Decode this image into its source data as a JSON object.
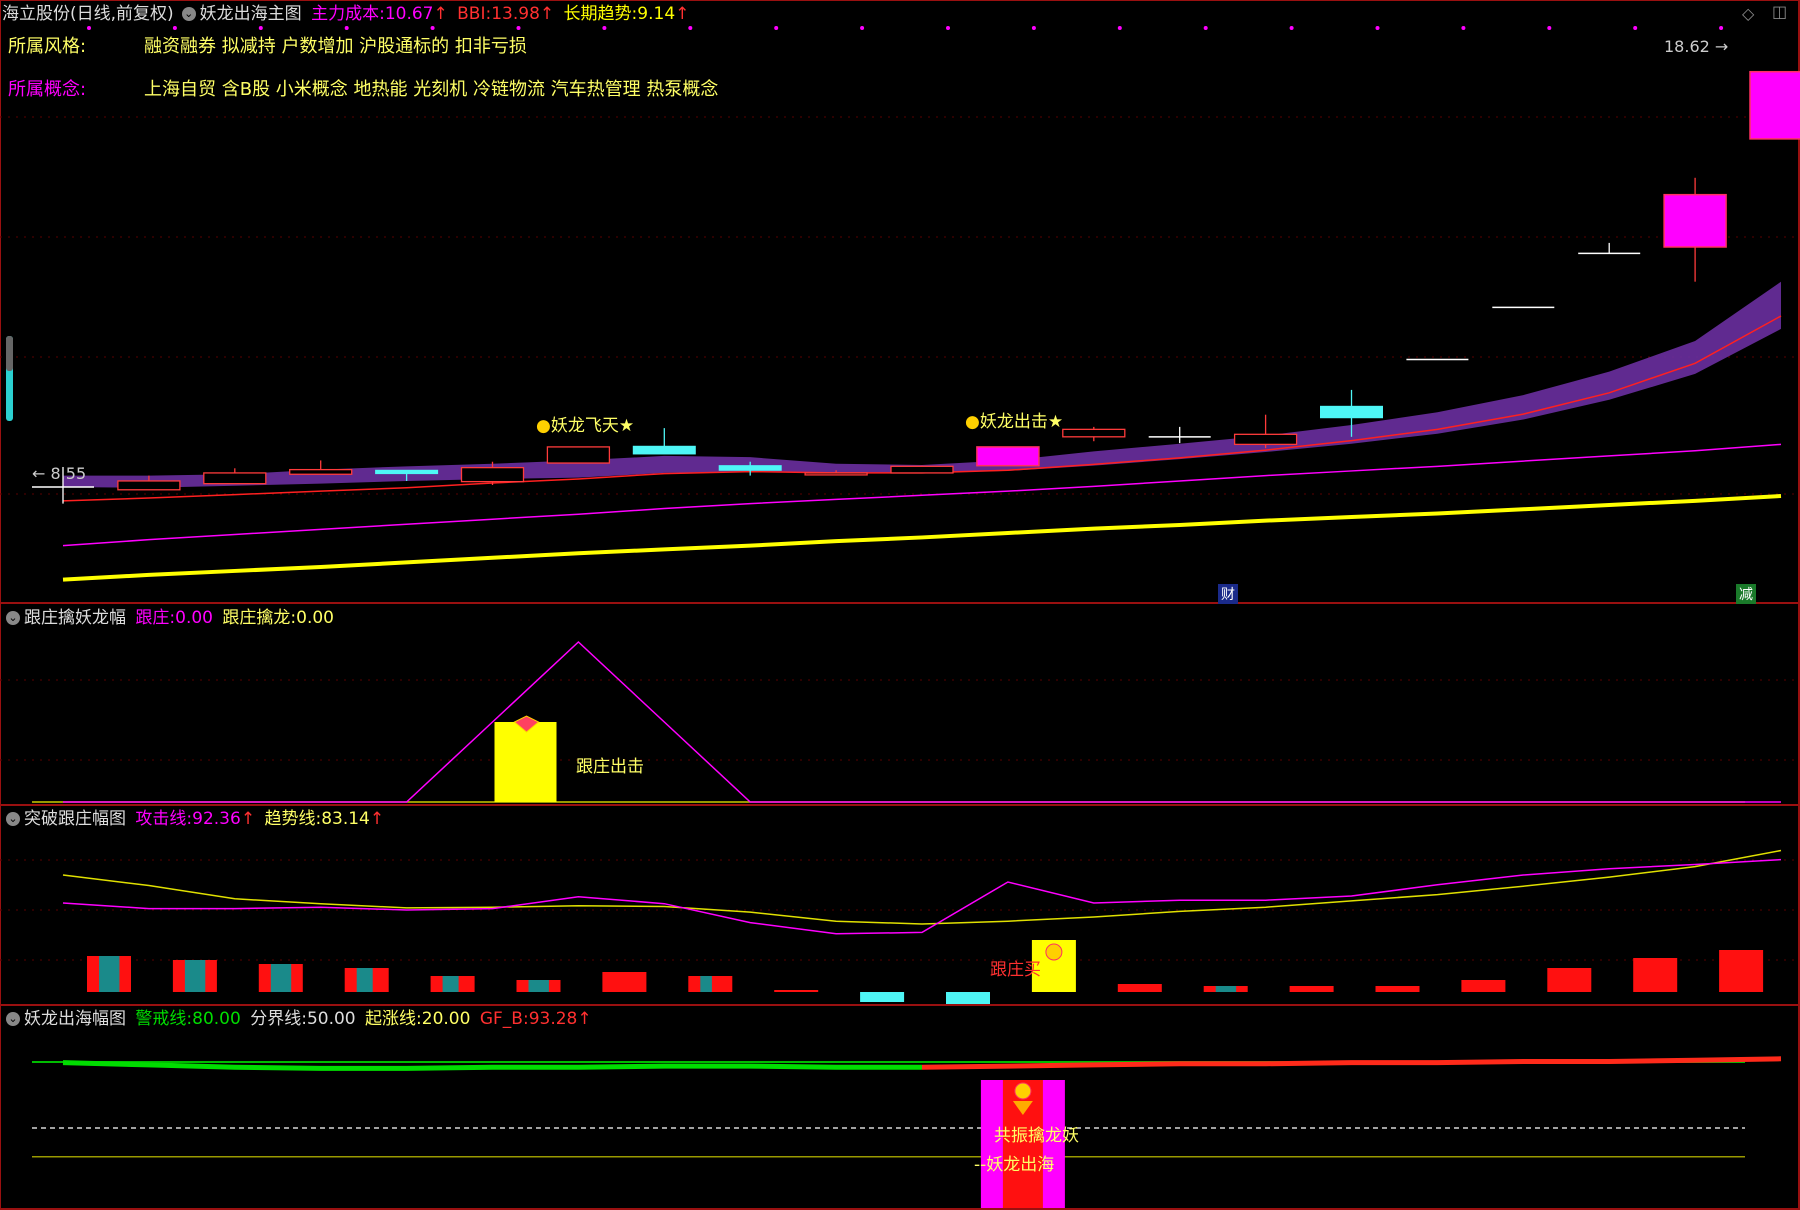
{
  "main_header": {
    "stock": "海立股份(日线,前复权)",
    "indicator": "妖龙出海主图",
    "cost_label": "主力成本:",
    "cost_value": "10.67",
    "bbi_label": "BBI:",
    "bbi_value": "13.98",
    "trend_label": "长期趋势:",
    "trend_value": "9.14"
  },
  "info": {
    "style_label": "所属风格:",
    "style_value": "融资融券 拟减持 户数增加 沪股通标的 扣非亏损",
    "concept_label": "所属概念:",
    "concept_value": "上海自贸 含B股 小米概念 地热能 光刻机 冷链物流 汽车热管理 热泵概念"
  },
  "price_labels": {
    "high": "18.62",
    "low": "8.55"
  },
  "signals": {
    "s1": "妖龙飞天★",
    "s2": "妖龙出击★"
  },
  "tags": {
    "cai": "财",
    "jian": "减"
  },
  "panel2": {
    "title": "跟庄擒妖龙幅",
    "a_label": "跟庄:",
    "a_value": "0.00",
    "b_label": "跟庄擒龙:",
    "b_value": "0.00",
    "signal": "跟庄出击"
  },
  "panel3": {
    "title": "突破跟庄幅图",
    "a_label": "攻击线:",
    "a_value": "92.36",
    "b_label": "趋势线:",
    "b_value": "83.14",
    "signal": "跟庄买"
  },
  "panel4": {
    "title": "妖龙出海幅图",
    "a_label": "警戒线:",
    "a_value": "80.00",
    "b_label": "分界线:",
    "b_value": "50.00",
    "c_label": "起涨线:",
    "c_value": "20.00",
    "d_label": "GF_B:",
    "d_value": "93.28",
    "signal1": "共振擒龙妖",
    "signal2": "妖龙出海"
  },
  "colors": {
    "up": "#ff3b3b",
    "down": "#4ef6f6",
    "magenta": "#ff00ff",
    "yellow": "#ffff00",
    "purple": "#6a2fa0",
    "green": "#00dd00",
    "bg": "#000000"
  },
  "chart_data": {
    "type": "candlestick",
    "x": [
      1,
      2,
      3,
      4,
      5,
      6,
      7,
      8,
      9,
      10,
      11,
      12,
      13,
      14,
      15,
      16,
      17,
      18,
      19,
      20,
      21
    ],
    "candles": [
      {
        "o": 8.79,
        "h": 9.09,
        "l": 8.55,
        "c": 8.79
      },
      {
        "o": 8.75,
        "h": 8.96,
        "l": 8.75,
        "c": 8.88
      },
      {
        "o": 8.84,
        "h": 9.07,
        "l": 8.84,
        "c": 9.0
      },
      {
        "o": 8.98,
        "h": 9.19,
        "l": 8.98,
        "c": 9.05
      },
      {
        "o": 9.04,
        "h": 9.04,
        "l": 8.88,
        "c": 8.99
      },
      {
        "o": 8.87,
        "h": 9.17,
        "l": 8.82,
        "c": 9.08
      },
      {
        "o": 9.15,
        "h": 9.4,
        "l": 9.15,
        "c": 9.4
      },
      {
        "o": 9.41,
        "h": 9.7,
        "l": 9.29,
        "c": 9.29
      },
      {
        "o": 9.11,
        "h": 9.17,
        "l": 8.96,
        "c": 9.04
      },
      {
        "o": 8.97,
        "h": 9.04,
        "l": 8.97,
        "c": 9.0
      },
      {
        "o": 9.0,
        "h": 9.11,
        "l": 9.0,
        "c": 9.1
      },
      {
        "o": 9.11,
        "h": 9.4,
        "l": 9.11,
        "c": 9.4
      },
      {
        "o": 9.56,
        "h": 9.72,
        "l": 9.49,
        "c": 9.68
      },
      {
        "o": 9.56,
        "h": 9.72,
        "l": 9.46,
        "c": 9.56
      },
      {
        "o": 9.44,
        "h": 9.92,
        "l": 9.38,
        "c": 9.6
      },
      {
        "o": 10.06,
        "h": 10.34,
        "l": 9.56,
        "c": 9.87
      },
      {
        "o": 10.88,
        "h": 10.88,
        "l": 10.88,
        "c": 10.88
      },
      {
        "o": 11.87,
        "h": 11.87,
        "l": 11.87,
        "c": 11.87
      },
      {
        "o": 12.99,
        "h": 13.22,
        "l": 12.99,
        "c": 12.99
      },
      {
        "o": 13.13,
        "h": 14.74,
        "l": 12.39,
        "c": 14.33
      },
      {
        "o": 15.73,
        "h": 17.6,
        "l": 15.73,
        "c": 17.6
      }
    ],
    "marks": {
      "high": 18.62,
      "low": 8.55
    },
    "band_upper": [
      8.96,
      8.96,
      8.98,
      9.05,
      9.1,
      9.14,
      9.19,
      9.26,
      9.24,
      9.14,
      9.12,
      9.19,
      9.33,
      9.45,
      9.58,
      9.75,
      9.96,
      10.25,
      10.66,
      11.22,
      12.39
    ],
    "band_lower": [
      8.79,
      8.78,
      8.81,
      8.84,
      8.88,
      8.91,
      8.93,
      9.0,
      9.02,
      9.0,
      9.0,
      9.03,
      9.11,
      9.21,
      9.32,
      9.45,
      9.61,
      9.84,
      10.17,
      10.62,
      11.45
    ],
    "red_line": [
      8.59,
      8.63,
      8.68,
      8.73,
      8.78,
      8.85,
      8.91,
      8.99,
      9.02,
      9.0,
      9.0,
      9.04,
      9.13,
      9.23,
      9.35,
      9.5,
      9.68,
      9.93,
      10.29,
      10.81,
      11.7
    ],
    "ma_magenta": [
      7.97,
      8.05,
      8.12,
      8.19,
      8.26,
      8.33,
      8.4,
      8.48,
      8.55,
      8.61,
      8.67,
      8.73,
      8.8,
      8.88,
      8.96,
      9.03,
      9.1,
      9.18,
      9.26,
      9.34,
      9.44
    ],
    "trend_yellow": [
      7.53,
      7.59,
      7.64,
      7.69,
      7.75,
      7.81,
      7.87,
      7.92,
      7.97,
      8.03,
      8.08,
      8.14,
      8.2,
      8.25,
      8.31,
      8.36,
      8.41,
      8.47,
      8.53,
      8.59,
      8.66
    ],
    "panel2": {
      "magenta": [
        0,
        0,
        0,
        0,
        0,
        80,
        160,
        80,
        0,
        0,
        0,
        0,
        0,
        0,
        0,
        0,
        0,
        0,
        0,
        0,
        0
      ],
      "yellow_bar_index": 7,
      "bar_value": 80
    },
    "panel3": {
      "attack_magenta": [
        60,
        52,
        52,
        54,
        50,
        52,
        69,
        59,
        32,
        16,
        18,
        90,
        60,
        64,
        64,
        70,
        86,
        100,
        109,
        115,
        122
      ],
      "trend_yellow": [
        100,
        85,
        66,
        59,
        53,
        54,
        56,
        55,
        47,
        34,
        30,
        34,
        40,
        48,
        54,
        63,
        72,
        84,
        97,
        112,
        135
      ],
      "bars": [
        18,
        16,
        14,
        12,
        8,
        6,
        10,
        8,
        1,
        -5,
        -6,
        20,
        4,
        3,
        3,
        3,
        6,
        12,
        17,
        21,
        23
      ],
      "bar_cyan_fraction": [
        0.6,
        0.6,
        0.6,
        0.5,
        0.5,
        0.6,
        0,
        0.4,
        0,
        1,
        1,
        0,
        0,
        0.6,
        0,
        0,
        0,
        0,
        0,
        0,
        0
      ]
    },
    "panel4": {
      "gf_b": [
        90,
        88,
        86,
        85,
        85,
        86,
        86,
        87,
        87,
        86,
        86,
        87,
        88,
        89,
        89,
        90,
        90,
        91,
        91,
        92,
        93.28
      ],
      "levels": {
        "alert": 80,
        "divide": 50,
        "start": 20
      },
      "bar_index": 11
    }
  }
}
